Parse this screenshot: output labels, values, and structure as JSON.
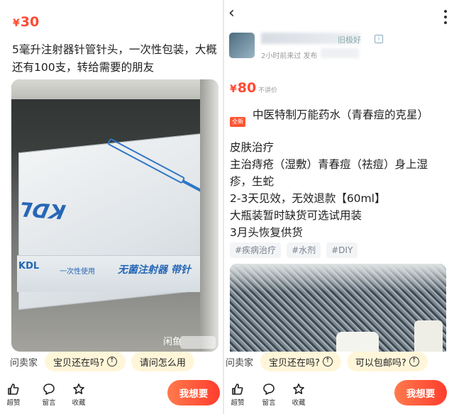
{
  "left": {
    "price": {
      "symbol": "¥",
      "value": "30"
    },
    "description": "5毫升注射器针管针头，一次性包装，大概还有100支，转给需要的朋友",
    "photo": {
      "brand_big": "KDL",
      "brand_small": "KDL",
      "label_1": "一次性使用",
      "label_2": "无菌注射器 带针",
      "watermark": "闲鱼"
    },
    "chips": {
      "ask_seller": "问卖家",
      "items": [
        "宝贝还在吗?",
        "请问怎么用"
      ]
    },
    "actions": {
      "like": "超赞",
      "comment": "留言",
      "favorite": "收藏"
    },
    "want_button": "我想要"
  },
  "right": {
    "seller": {
      "name": "旧极好",
      "meta": "2小时前来过 发布"
    },
    "price": {
      "symbol": "¥",
      "value": "80",
      "note": "不讲价"
    },
    "new_tag": "全新",
    "title": "中医特制万能药水（青春痘的克星）",
    "body": [
      "皮肤治疗",
      "主治痔疮（湿敷）青春痘（祛痘）身上湿疹，生蛇",
      "2-3天见效，无效退款【60ml】",
      "大瓶装暂时缺货可选试用装",
      "3月头恢复供货"
    ],
    "tags": [
      "#疾病治疗",
      "#水剂",
      "#DIY"
    ],
    "chips": {
      "ask_seller": "问卖家",
      "items": [
        "宝贝还在吗?",
        "可以包邮吗?"
      ]
    },
    "actions": {
      "like": "超赞",
      "comment": "留言",
      "favorite": "收藏"
    },
    "want_button": "我想要"
  },
  "colors": {
    "accent": "#ff4a33",
    "chip_bg": "#fff6d9",
    "tag_bg": "#f3f4f6"
  }
}
